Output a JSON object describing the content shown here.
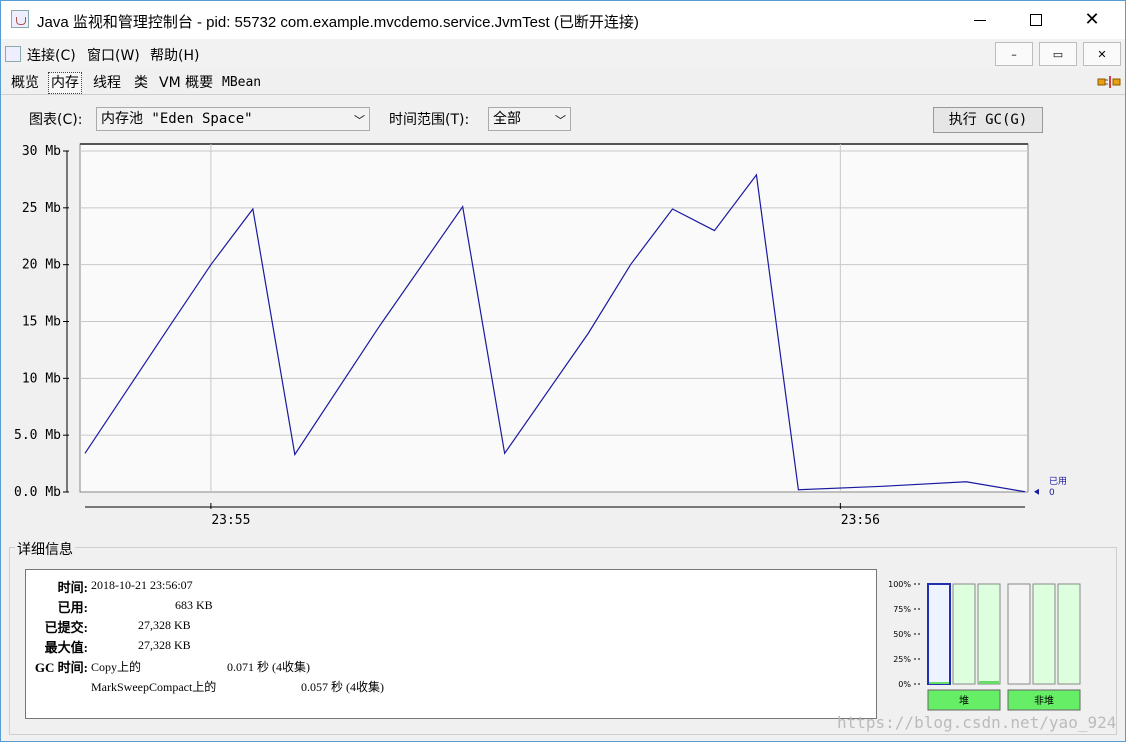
{
  "window": {
    "title": "Java 监视和管理控制台 - pid: 55732 com.example.mvcdemo.service.JvmTest (已断开连接)",
    "minimize_symbol": "—",
    "close_symbol": "✕"
  },
  "menu": {
    "items": [
      "连接(C)",
      "窗口(W)",
      "帮助(H)"
    ],
    "inner_buttons": [
      "–",
      "▭",
      "✕"
    ]
  },
  "tabs": {
    "items": [
      "概览",
      "内存",
      "线程",
      "类",
      "VM 概要",
      "MBean"
    ],
    "active": "内存"
  },
  "controls": {
    "chart_label": "图表(C):",
    "chart_value": "内存池 \"Eden Space\"",
    "range_label": "时间范围(T):",
    "range_value": "全部",
    "gc_button": "执行 GC(G)"
  },
  "chart_data": {
    "type": "line",
    "ylabel": "",
    "xlabel": "",
    "ylim": [
      0,
      30
    ],
    "ytick_labels": [
      "0.0 Mb",
      "5.0 Mb",
      "10 Mb",
      "15 Mb",
      "20 Mb",
      "25 Mb",
      "30 Mb"
    ],
    "yticks": [
      0,
      5,
      10,
      15,
      20,
      25,
      30
    ],
    "xlim": [
      0,
      112
    ],
    "xtick_labels": [
      "23:55",
      "23:56"
    ],
    "xticks": [
      15,
      90
    ],
    "series": [
      {
        "name": "已用",
        "color": "#1a1aa0",
        "x": [
          0,
          10,
          15,
          20,
          25,
          35,
          45,
          50,
          60,
          65,
          70,
          75,
          80,
          85,
          95,
          105,
          112
        ],
        "values": [
          3.4,
          14.5,
          20,
          24.9,
          3.3,
          14.5,
          25.1,
          3.4,
          14,
          20,
          24.9,
          23,
          27.9,
          0.2,
          0.5,
          0.9,
          0.02
        ]
      }
    ],
    "legend_value": "0"
  },
  "details": {
    "title": "详细信息",
    "time_label": "时间:",
    "time_value": "2018-10-21 23:56:07",
    "used_label": "已用:",
    "used_value": "683 KB",
    "committed_label": "已提交:",
    "committed_value": "27,328 KB",
    "max_label": "最大值:",
    "max_value": "27,328 KB",
    "gc_label": "GC 时间:",
    "gc1_name": "Copy上的",
    "gc1_value": "0.071 秒 (4收集)",
    "gc2_name": "MarkSweepCompact上的",
    "gc2_value": "0.057 秒 (4收集)"
  },
  "pool_bars": {
    "ticks": [
      "100%",
      "75%",
      "50%",
      "25%",
      "0%"
    ],
    "heap_label": "堆",
    "nonheap_label": "非堆",
    "heap_fill": [
      0.02,
      0.0,
      0.03
    ],
    "nonheap_fill": [
      0.0,
      0.0,
      0.0
    ]
  },
  "watermark": "https://blog.csdn.net/yao_924"
}
